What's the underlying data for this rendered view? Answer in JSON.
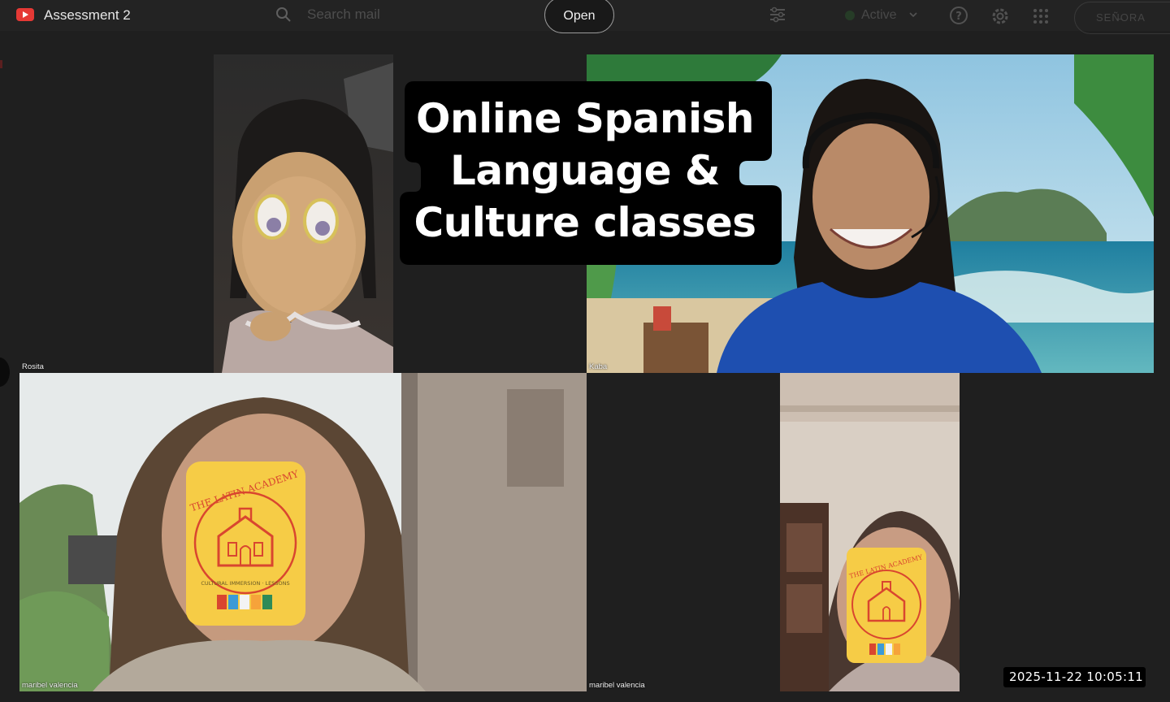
{
  "window": {
    "title": "Assessment 2"
  },
  "search": {
    "placeholder": "Search mail"
  },
  "toolbar": {
    "open_label": "Open",
    "status_label": "Active"
  },
  "account": {
    "label": "SEÑ̶ORA"
  },
  "overlay": {
    "title_lines": [
      "Online Spanish",
      "Language &",
      "Culture classes"
    ]
  },
  "badge": {
    "text": "THE LATIN ACADEMY",
    "subtext": "CULTURAL IMMERSION · LESSONS"
  },
  "participants": [
    {
      "name": "Rosita"
    },
    {
      "name": "Kaba"
    },
    {
      "name": "maribel valencia"
    },
    {
      "name": "maribel valencia"
    }
  ],
  "timestamp": {
    "text": "2025-11-22  10:05:11"
  },
  "colors": {
    "badge_yellow": "#f6cc46",
    "badge_red": "#d9462f",
    "overlay_bg": "#000000"
  }
}
